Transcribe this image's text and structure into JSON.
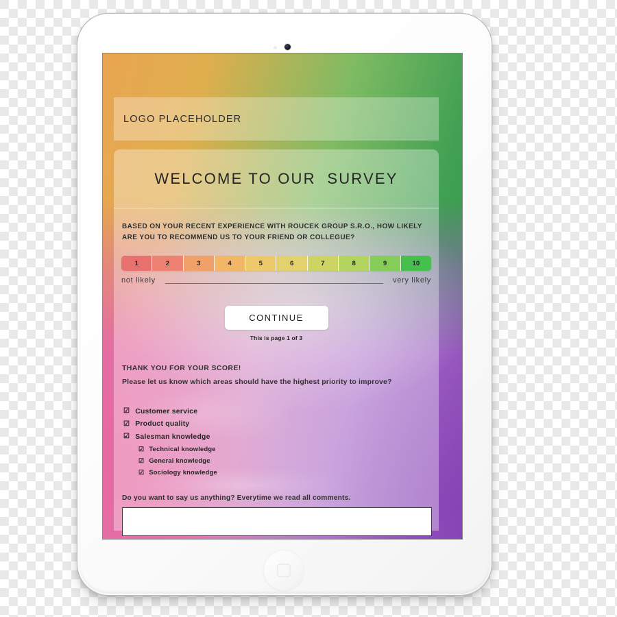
{
  "device": {
    "type": "tablet",
    "camera_icon": "camera-icon",
    "sensor_icon": "light-sensor-icon",
    "home_button_icon": "home-button-icon"
  },
  "screen": {
    "background_colors": {
      "top_left": "#e9a551",
      "top_right": "#35994c",
      "bottom_left": "#e4619a",
      "bottom_right": "#8d4cb8"
    }
  },
  "header": {
    "logo_text": "LOGO PLACEHOLDER"
  },
  "welcome": {
    "title": "WELCOME TO OUR  SURVEY"
  },
  "question": {
    "line1": "BASED ON YOUR RECENT EXPERIENCE WITH ROUCEK GROUP S.R.O., HOW LIKELY",
    "line2": "ARE YOU TO RECOMMEND US TO YOUR FRIEND OR COLLEGUE?"
  },
  "scale": {
    "values": [
      "1",
      "2",
      "3",
      "4",
      "5",
      "6",
      "7",
      "8",
      "9",
      "10"
    ],
    "colors": [
      "#e8706e",
      "#ee8272",
      "#f0a069",
      "#f2b667",
      "#eec96a",
      "#e2d16c",
      "#cdd464",
      "#b3d45f",
      "#86cc58",
      "#45c04f"
    ],
    "anchor_low": "not likely",
    "anchor_high": "very likely"
  },
  "actions": {
    "continue_label": "CONTINUE",
    "page_note": "This is page 1 of 3"
  },
  "thanks": {
    "heading": "THANK YOU FOR YOUR SCORE!",
    "subheading": "Please let us know which areas should have the highest priority to improve?"
  },
  "options": [
    {
      "label": "Customer service",
      "checked": true,
      "checkbox_glyph": "☑",
      "sub": false
    },
    {
      "label": "Product quality",
      "checked": true,
      "checkbox_glyph": "☑",
      "sub": false
    },
    {
      "label": "Salesman knowledge",
      "checked": true,
      "checkbox_glyph": "☑",
      "sub": false
    },
    {
      "label": "Technical knowledge",
      "checked": true,
      "checkbox_glyph": "☑",
      "sub": true
    },
    {
      "label": "General knowledge",
      "checked": true,
      "checkbox_glyph": "☑",
      "sub": true
    },
    {
      "label": "Sociology knowledge",
      "checked": true,
      "checkbox_glyph": "☑",
      "sub": true
    }
  ],
  "comment": {
    "label": "Do you want to say us anything? Everytime we read all comments.",
    "value": "",
    "placeholder": ""
  }
}
